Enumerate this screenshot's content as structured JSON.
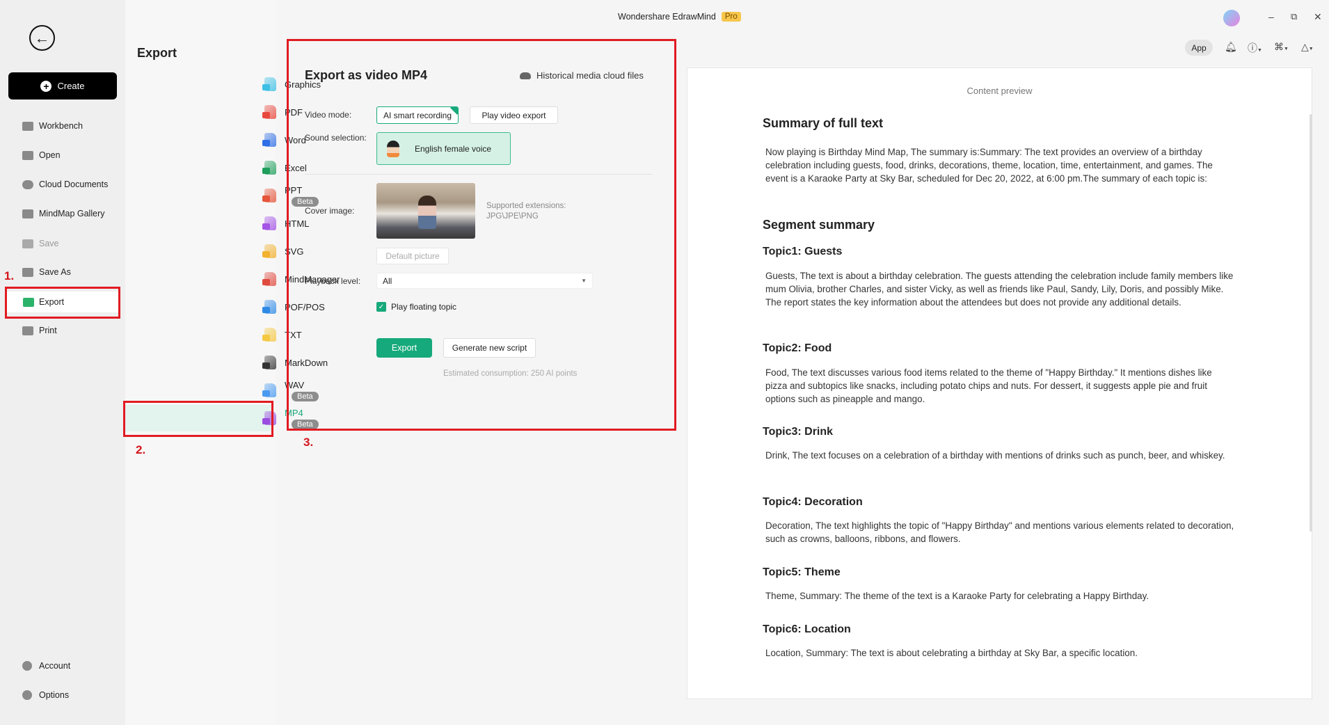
{
  "titlebar": {
    "app_name": "Wondershare EdrawMind",
    "badge": "Pro",
    "app_button": "App"
  },
  "nav": {
    "create": "Create",
    "items": [
      {
        "label": "Workbench",
        "icon": "workbench-icon"
      },
      {
        "label": "Open",
        "icon": "folder-icon"
      },
      {
        "label": "Cloud Documents",
        "icon": "cloud-icon"
      },
      {
        "label": "MindMap Gallery",
        "icon": "gallery-icon"
      },
      {
        "label": "Save",
        "icon": "save-icon",
        "disabled": true
      },
      {
        "label": "Save As",
        "icon": "save-as-icon"
      },
      {
        "label": "Export",
        "icon": "export-icon",
        "active": true
      },
      {
        "label": "Print",
        "icon": "print-icon"
      }
    ],
    "bottom": [
      {
        "label": "Account",
        "icon": "account-icon"
      },
      {
        "label": "Options",
        "icon": "gear-icon"
      }
    ]
  },
  "export_menu": {
    "title": "Export",
    "items": [
      {
        "label": "Graphics",
        "color": "#3cc0e6"
      },
      {
        "label": "PDF",
        "color": "#e8473d"
      },
      {
        "label": "Word",
        "color": "#2f6ee6"
      },
      {
        "label": "Excel",
        "color": "#1e9e5a"
      },
      {
        "label": "PPT",
        "color": "#e5553a",
        "badge": "Beta"
      },
      {
        "label": "HTML",
        "color": "#a454e6"
      },
      {
        "label": "SVG",
        "color": "#f2b12f"
      },
      {
        "label": "MindManager",
        "color": "#e04a3f"
      },
      {
        "label": "POF/POS",
        "color": "#2f8ae6"
      },
      {
        "label": "TXT",
        "color": "#f5c842"
      },
      {
        "label": "MarkDown",
        "color": "#333333"
      },
      {
        "label": "WAV",
        "color": "#4a9af0",
        "badge": "Beta"
      },
      {
        "label": "MP4",
        "color": "#9a4de0",
        "badge": "Beta",
        "selected": true
      }
    ]
  },
  "annotations": {
    "step1": "1.",
    "step2": "2.",
    "step3": "3."
  },
  "mp4": {
    "title": "Export as video MP4",
    "history_link": "Historical media cloud files",
    "video_mode_label": "Video mode:",
    "video_modes": [
      "AI smart recording",
      "Play video export"
    ],
    "sound_label": "Sound selection:",
    "voice": "English female voice",
    "cover_label": "Cover image:",
    "supported_label": "Supported extensions:",
    "supported_value": "JPG\\JPE\\PNG",
    "default_picture": "Default picture",
    "playback_label": "Playback level:",
    "playback_value": "All",
    "floating_topic": "Play floating topic",
    "floating_checked": true,
    "export_button": "Export",
    "generate_button": "Generate new script",
    "estimate": "Estimated consumption: 250 AI points"
  },
  "preview": {
    "label": "Content preview",
    "summary_title": "Summary of full text",
    "summary": "Now playing is Birthday Mind Map, The summary is:Summary: The text provides an overview of a birthday celebration including guests, food, drinks, decorations, theme, location, time, entertainment, and games. The event is a Karaoke Party at Sky Bar, scheduled for Dec 20, 2022, at 6:00 pm.The summary of each topic is:",
    "segment_title": "Segment summary",
    "topics": [
      {
        "title": "Topic1: Guests",
        "text": "Guests, The text is about a birthday celebration. The guests attending the celebration include family members like mum Olivia, brother Charles, and sister Vicky, as well as friends like Paul, Sandy, Lily, Doris, and possibly Mike. The report states the key information about the attendees but does not provide any additional details."
      },
      {
        "title": "Topic2: Food",
        "text": "Food, The text discusses various food items related to the theme of \"Happy Birthday.\" It mentions dishes like pizza and subtopics like snacks, including potato chips and nuts. For dessert, it suggests apple pie and fruit options such as pineapple and mango."
      },
      {
        "title": "Topic3: Drink",
        "text": "Drink, The text focuses on a celebration of a birthday with mentions of drinks such as punch, beer, and whiskey."
      },
      {
        "title": "Topic4: Decoration",
        "text": "Decoration, The text highlights the topic of \"Happy Birthday\" and mentions various elements related to decoration, such as crowns, balloons, ribbons, and flowers."
      },
      {
        "title": "Topic5: Theme",
        "text": "Theme, Summary: The theme of the text is a Karaoke Party for celebrating a Happy Birthday."
      },
      {
        "title": "Topic6: Location",
        "text": "Location, Summary: The text is about celebrating a birthday at Sky Bar, a specific location."
      }
    ]
  },
  "colors": {
    "accent": "#16a97b",
    "annotation_red": "#e11b22",
    "pro_badge": "#f7c64b"
  }
}
